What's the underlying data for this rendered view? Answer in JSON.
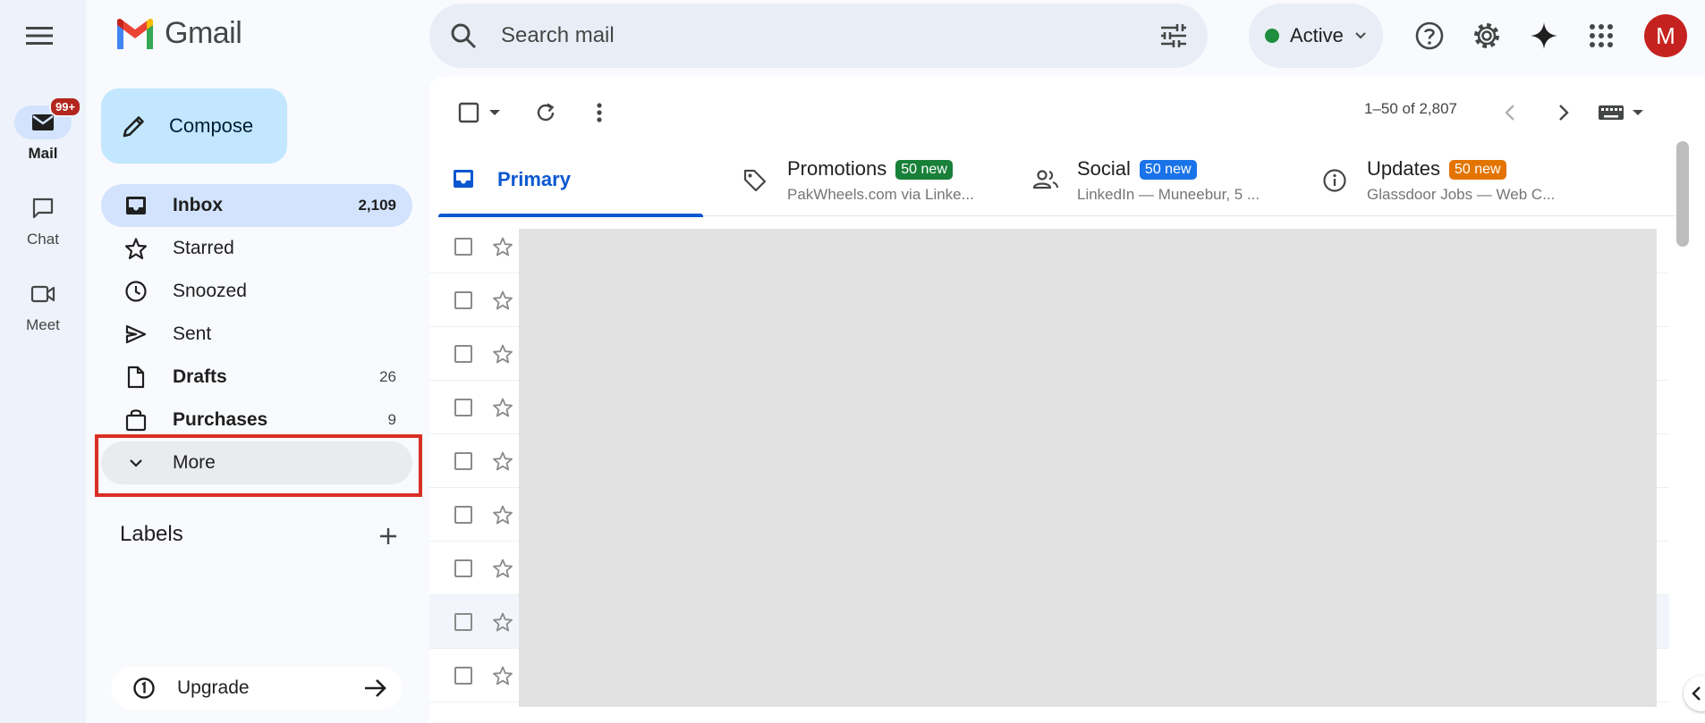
{
  "app": {
    "name": "Gmail"
  },
  "rail": [
    {
      "label": "Mail",
      "badge": "99+"
    },
    {
      "label": "Chat"
    },
    {
      "label": "Meet"
    }
  ],
  "search": {
    "placeholder": "Search mail"
  },
  "status": {
    "label": "Active",
    "color": "#1e8e3e"
  },
  "account": {
    "initial": "M",
    "color": "#c5221f"
  },
  "compose": {
    "label": "Compose"
  },
  "nav": [
    {
      "label": "Inbox",
      "count": "2,109"
    },
    {
      "label": "Starred",
      "count": ""
    },
    {
      "label": "Snoozed",
      "count": ""
    },
    {
      "label": "Sent",
      "count": ""
    },
    {
      "label": "Drafts",
      "count": "26"
    },
    {
      "label": "Purchases",
      "count": "9"
    },
    {
      "label": "More",
      "count": ""
    }
  ],
  "labels": {
    "title": "Labels"
  },
  "upgrade": {
    "label": "Upgrade"
  },
  "pagination": {
    "text": "1–50 of 2,807"
  },
  "tabs": [
    {
      "label": "Primary",
      "badge": "",
      "snippet": ""
    },
    {
      "label": "Promotions",
      "badge": "50 new",
      "snippet": "PakWheels.com via Linke...",
      "badge_color": "#188038"
    },
    {
      "label": "Social",
      "badge": "50 new",
      "snippet": "LinkedIn — Muneebur, 5 ...",
      "badge_color": "#1a73e8"
    },
    {
      "label": "Updates",
      "badge": "50 new",
      "snippet": "Glassdoor Jobs — Web C...",
      "badge_color": "#e37400"
    }
  ],
  "colors": {
    "accent": "#0b57d0",
    "highlight_box": "#d93025"
  }
}
